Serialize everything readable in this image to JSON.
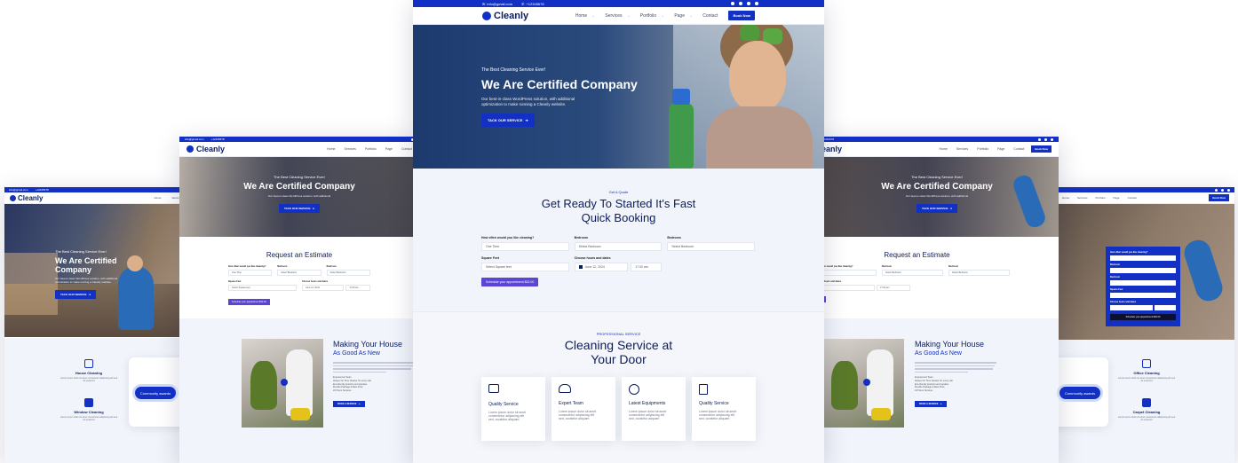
{
  "brand": {
    "name": "Cleanly",
    "primary": "#1230c4",
    "navy": "#0b1d5c",
    "purple": "#5b44d6",
    "light_bg": "#f1f4fa"
  },
  "topbar": {
    "email": "info@gmail.com",
    "phone": "+12345678"
  },
  "nav": {
    "items": [
      "Home",
      "Services",
      "Portfolio",
      "Page",
      "Contact"
    ],
    "book_label": "Book Now"
  },
  "hero": {
    "eyebrow": "The Best Cleaning Service Ever!",
    "title": "We Are Certified Company",
    "title_line1": "We Are Certified",
    "title_line2": "Company",
    "desc_line1": "Our best-in-class WordPress solution, with additional",
    "desc_line2": "optimization to make running a Cleanly website.",
    "button": "TACK OUR SERVICE"
  },
  "quote": {
    "eyebrow": "Get A Quote",
    "title_line1": "Get Ready To Started It's Fast",
    "title_line2": "Quick Booking",
    "small_title": "Request an Estimate",
    "fields": {
      "often_label": "How often would you like cleaning?",
      "often_value": "One Time",
      "bedroom_label": "Bedroom",
      "bedroom_value": "Select Bedroom",
      "bathroom_label": "Bedroom",
      "bathroom_value": "Select Bedroom",
      "service_label": "Square Feet",
      "service_value": "Select Square feet",
      "date_label": "Choose hours and dates",
      "date_value": "June 12, 2024",
      "time_value": "17:00 am"
    },
    "submit": "Schedule your appointment $32.00",
    "submit_small": "Schedule your appointment $32.00"
  },
  "services": {
    "eyebrow": "PROFESSIONAL SERVICE",
    "title_line1": "Cleaning Service at",
    "title_line2": "Your Door",
    "items": [
      {
        "title": "Quality Service",
        "icon": "briefcase-icon",
        "desc1": "Lorem ipsum dolor sit amet",
        "desc2": "consectetur adipiscing elit",
        "desc3": "sed, curabitur aliquam"
      },
      {
        "title": "Expert Team",
        "icon": "team-icon",
        "desc1": "Lorem ipsum dolor sit amet",
        "desc2": "consectetur adipiscing elit",
        "desc3": "sed, curabitur aliquam"
      },
      {
        "title": "Latest Equipments",
        "icon": "gear-hand-icon",
        "desc1": "Lorem ipsum dolor sit amet",
        "desc2": "consectetur adipiscing elit",
        "desc3": "sed, curabitur aliquam"
      },
      {
        "title": "Quality Service",
        "icon": "document-icon",
        "desc1": "Lorem ipsum dolor sit amet",
        "desc2": "consectetur adipiscing elit",
        "desc3": "sed, curabitur aliquam"
      }
    ]
  },
  "about": {
    "title_line1": "Making Your House",
    "title_line2": "As Good As New",
    "list": [
      "Experienced Team",
      "Always On Time Cleaner for every visit",
      "Eco-friendly products and supplies",
      "Flexible Package & Best Price",
      "24 Hours Services"
    ],
    "button": "BOOK A SERVICE"
  },
  "features_left": [
    {
      "title": "House Cleaning",
      "icon": "house-icon",
      "desc": "Lorem ipsum dolor sit amet consectetur adipiscing elit sed do eiusmod"
    },
    {
      "title": "Window Cleaning",
      "icon": "window-icon",
      "desc": "Lorem ipsum dolor sit amet consectetur adipiscing elit sed do eiusmod"
    }
  ],
  "features_right": [
    {
      "title": "Office Cleaning",
      "icon": "office-icon",
      "desc": "Lorem ipsum dolor sit amet consectetur adipiscing elit sed do eiusmod"
    },
    {
      "title": "Carpet Cleaning",
      "icon": "carpet-icon",
      "desc": "Lorem ipsum dolor sit amet consectetur adipiscing elit sed do eiusmod"
    }
  ],
  "community": {
    "label": "Community awards"
  }
}
